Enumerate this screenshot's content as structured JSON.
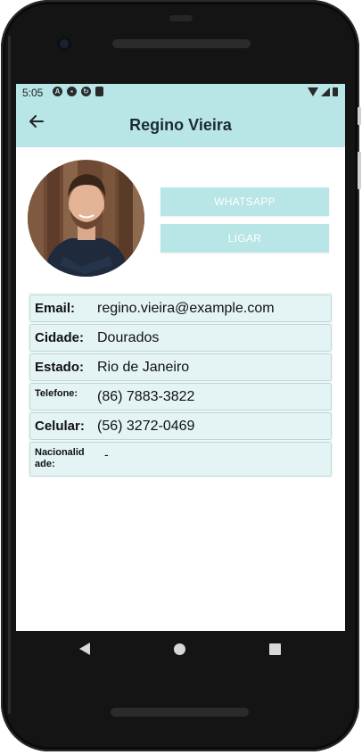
{
  "status_bar": {
    "time": "5:05",
    "left_icons": [
      "android-auto-icon",
      "shield-icon",
      "sync-icon",
      "sd-card-icon"
    ],
    "right_icons": [
      "wifi-icon",
      "signal-icon",
      "battery-icon"
    ]
  },
  "app_bar": {
    "title": "Regino Vieira",
    "back_icon": "arrow-left-icon"
  },
  "actions": {
    "whatsapp_label": "WHATSAPP",
    "call_label": "LIGAR"
  },
  "details": [
    {
      "label": "Email:",
      "value": "regino.vieira@example.com"
    },
    {
      "label": "Cidade:",
      "value": "Dourados"
    },
    {
      "label": "Estado:",
      "value": "Rio de Janeiro"
    },
    {
      "label": "Telefone:",
      "value": "(86) 7883-3822"
    },
    {
      "label": "Celular:",
      "value": "(56) 3272-0469"
    },
    {
      "label": "Nacionalidade:",
      "label_display": "Nacionalid\nade:",
      "value": "-"
    }
  ],
  "colors": {
    "accent": "#b8e5e5",
    "title": "#1c2a3a",
    "row_bg": "#e4f4f4"
  }
}
